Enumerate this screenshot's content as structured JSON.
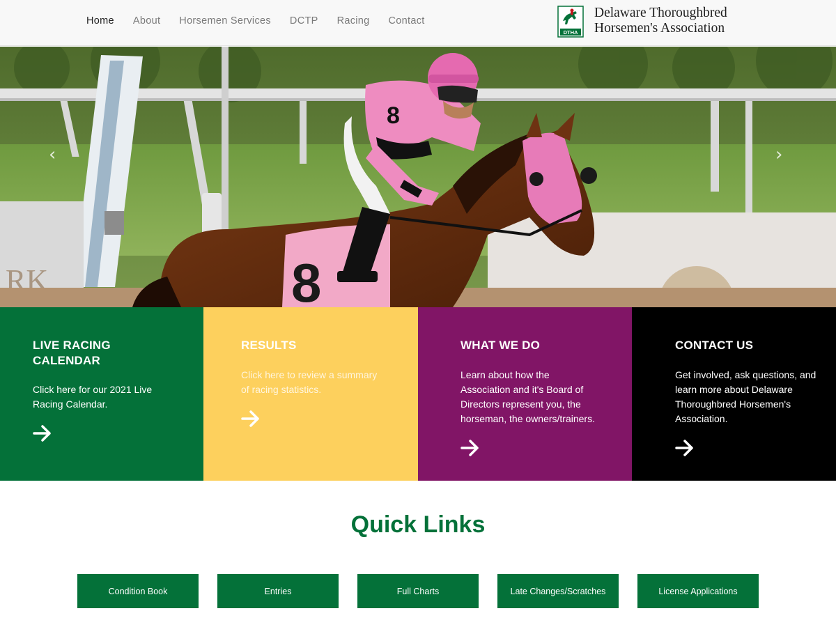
{
  "nav": {
    "links": [
      "Home",
      "About",
      "Horsemen Services",
      "DCTP",
      "Racing",
      "Contact"
    ],
    "active": "Home"
  },
  "logo": {
    "line1": "Delaware Thoroughbred",
    "line2": "Horsemen's Association",
    "badge": "DTHA",
    "icon": "horse-rider-logo-icon"
  },
  "hero": {
    "prev_icon": "chevron-left-icon",
    "next_icon": "chevron-right-icon",
    "prev_glyph": "‹",
    "next_glyph": "›"
  },
  "cards": [
    {
      "title_line1": "LIVE RACING",
      "title_line2": "CALENDAR",
      "text": "Click here for our 2021 Live Racing Calendar.",
      "icon": "arrow-right-icon",
      "color": "#047139"
    },
    {
      "title_line1": "RESULTS",
      "title_line2": "",
      "text": "Click here to review a summary of racing statistics.",
      "icon": "arrow-right-icon",
      "color": "#fdd05d"
    },
    {
      "title_line1": "WHAT WE DO",
      "title_line2": "",
      "text": "Learn about how the Association and it's Board of Directors represent you, the horseman, the owners/trainers.",
      "icon": "arrow-right-icon",
      "color": "#811566"
    },
    {
      "title_line1": "CONTACT US",
      "title_line2": "",
      "text": "Get involved, ask questions, and learn more about Delaware Thoroughbred Horsemen's Association.",
      "icon": "arrow-right-icon",
      "color": "#000000"
    }
  ],
  "quick_links": {
    "title": "Quick Links",
    "buttons": [
      "Condition Book",
      "Entries",
      "Full Charts",
      "Late Changes/Scratches",
      "License Applications"
    ]
  },
  "colors": {
    "brand_green": "#047139",
    "yellow": "#fdd05d",
    "purple": "#811566",
    "black": "#000000"
  }
}
